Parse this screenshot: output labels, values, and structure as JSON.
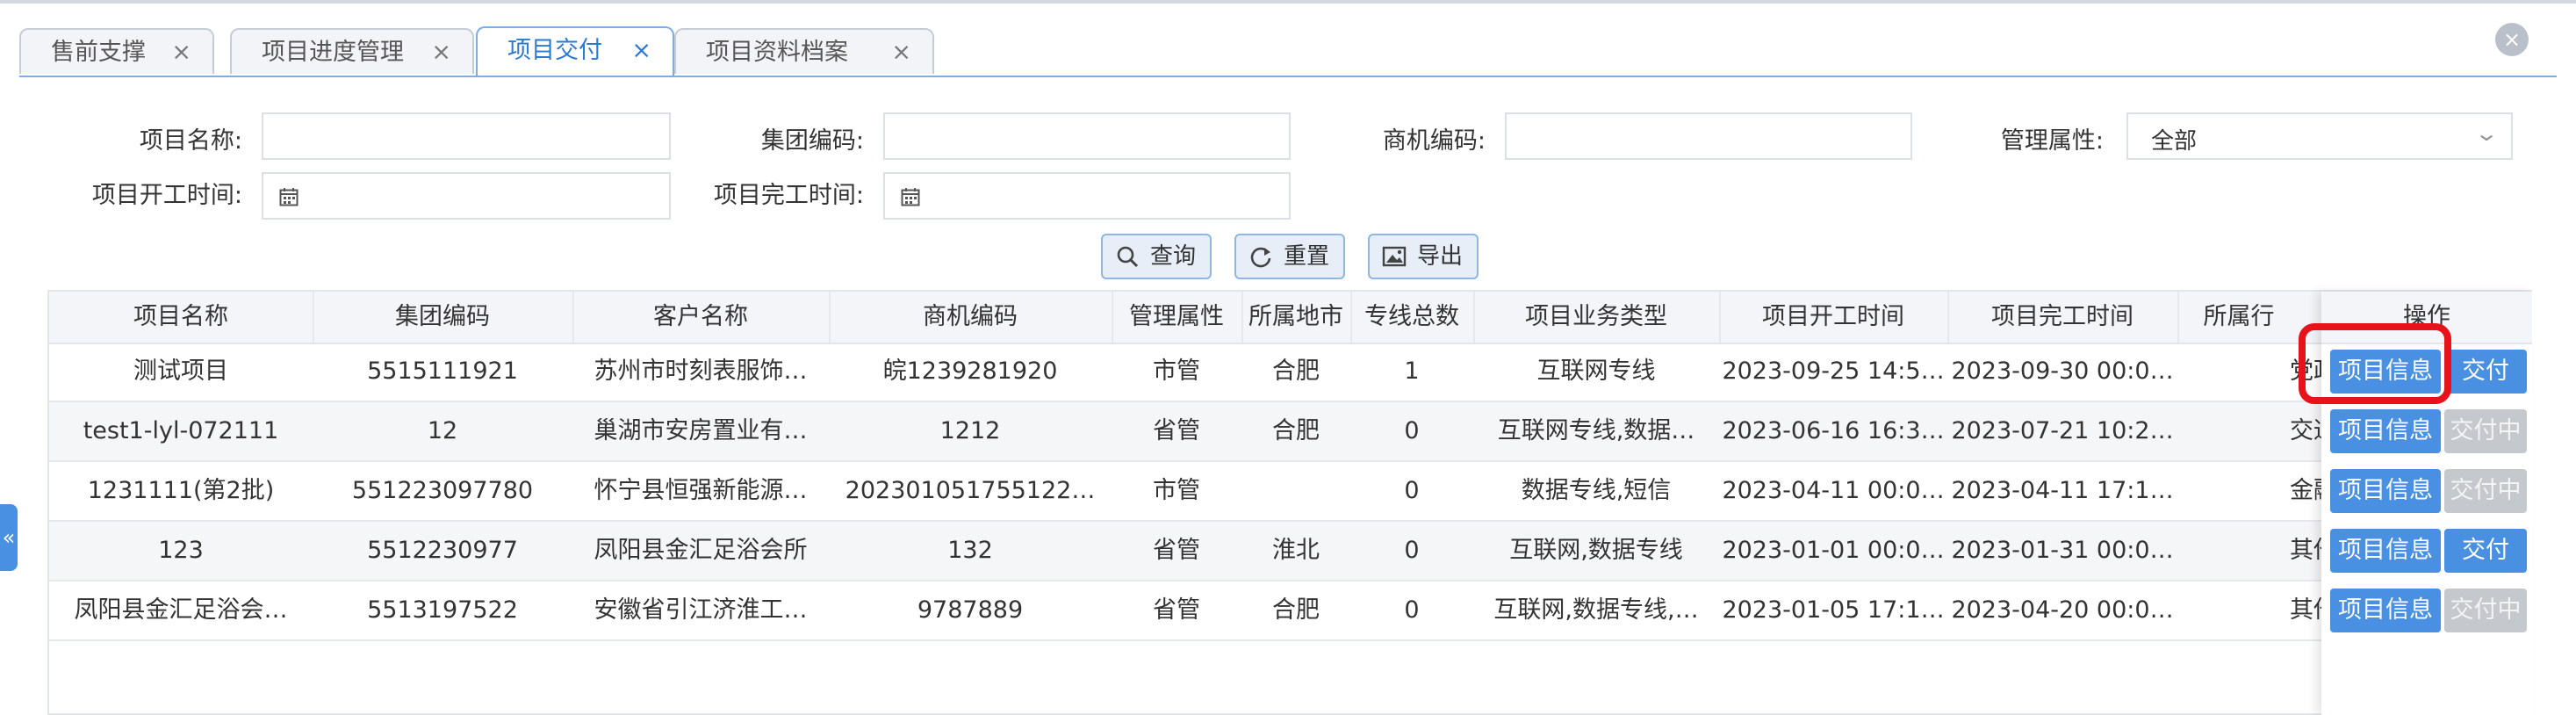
{
  "tabs": [
    {
      "label": "售前支撑",
      "close": "×"
    },
    {
      "label": "项目进度管理",
      "close": "×"
    },
    {
      "label": "项目交付",
      "close": "×"
    },
    {
      "label": "项目资料档案",
      "close": "×"
    }
  ],
  "window_close": "×",
  "filters": {
    "project_name_label": "项目名称:",
    "group_code_label": "集团编码:",
    "opportunity_code_label": "商机编码:",
    "mgmt_attr_label": "管理属性:",
    "mgmt_attr_value": "全部",
    "start_time_label": "项目开工时间:",
    "finish_time_label": "项目完工时间:"
  },
  "actions": {
    "query": "查询",
    "reset": "重置",
    "export": "导出"
  },
  "table": {
    "columns": [
      "项目名称",
      "集团编码",
      "客户名称",
      "商机编码",
      "管理属性",
      "所属地市",
      "专线总数",
      "项目业务类型",
      "项目开工时间",
      "项目完工时间",
      "所属行"
    ],
    "op_header": "操作",
    "rows": [
      {
        "cells": [
          "测试项目",
          "5515111921",
          "苏州市时刻表服饰…",
          "皖1239281920",
          "市管",
          "合肥",
          "1",
          "互联网专线",
          "2023-09-25 14:5…",
          "2023-09-30 00:0…",
          "党政"
        ],
        "info": "项目信息",
        "deliver": "交付",
        "deliver_disabled": false
      },
      {
        "cells": [
          "test1-lyl-072111",
          "12",
          "巢湖市安房置业有…",
          "1212",
          "省管",
          "合肥",
          "0",
          "互联网专线,数据…",
          "2023-06-16 16:3…",
          "2023-07-21 10:2…",
          "交通"
        ],
        "info": "项目信息",
        "deliver": "交付中",
        "deliver_disabled": true
      },
      {
        "cells": [
          "1231111(第2批)",
          "551223097780",
          "怀宁县恒强新能源…",
          "202301051755122…",
          "市管",
          "",
          "0",
          "数据专线,短信",
          "2023-04-11 00:0…",
          "2023-04-11 17:1…",
          "金融"
        ],
        "info": "项目信息",
        "deliver": "交付中",
        "deliver_disabled": true
      },
      {
        "cells": [
          "123",
          "5512230977",
          "凤阳县金汇足浴会所",
          "132",
          "省管",
          "淮北",
          "0",
          "互联网,数据专线",
          "2023-01-01 00:0…",
          "2023-01-31 00:0…",
          "其他"
        ],
        "info": "项目信息",
        "deliver": "交付",
        "deliver_disabled": false
      },
      {
        "cells": [
          "凤阳县金汇足浴会…",
          "5513197522",
          "安徽省引江济淮工…",
          "9787889",
          "省管",
          "合肥",
          "0",
          "互联网,数据专线,…",
          "2023-01-05 17:1…",
          "2023-04-20 00:0…",
          "其他"
        ],
        "info": "项目信息",
        "deliver": "交付中",
        "deliver_disabled": true
      }
    ]
  },
  "sidebar_toggle": "«",
  "colors": {
    "accent": "#4a90e2",
    "highlight": "#e8121a",
    "disabled": "#c5c8cd"
  }
}
